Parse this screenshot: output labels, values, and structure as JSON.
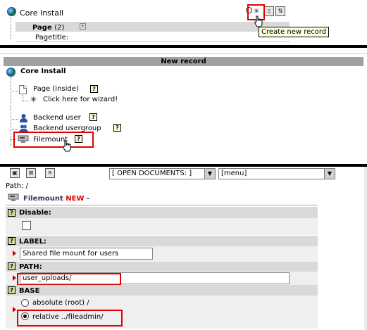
{
  "top_panel": {
    "root_label": "Core Install",
    "page_label": "Page",
    "page_count": "(2)",
    "pagetitle_label": "Pagetitle:",
    "tooltip": "Create new record"
  },
  "new_record_panel": {
    "header": "New record",
    "root_label": "Core Install",
    "items": [
      {
        "label": "Page (inside)"
      },
      {
        "label": "Click here for wizard!"
      },
      {
        "label": "Backend user"
      },
      {
        "label": "Backend usergroup"
      },
      {
        "label": "Filemount"
      }
    ]
  },
  "edit_panel": {
    "open_docs": "[ OPEN DOCUMENTS: ]",
    "menu": "[menu]",
    "path_label": "Path: /",
    "record_type": "Filemount",
    "record_status": "NEW",
    "record_suffix": "-",
    "fields": {
      "disable_label": "Disable:",
      "label_label": "LABEL:",
      "label_value": "Shared file mount for users",
      "path_label": "PATH:",
      "path_value": "user_uploads/",
      "base_label": "BASE",
      "base_options": [
        "absolute (root) /",
        "relative ../fileadmin/"
      ],
      "base_selected": 1
    }
  },
  "colors": {
    "highlight": "#e00000",
    "section_bg": "#d9d9d9",
    "header_bg": "#9fa0a0"
  }
}
